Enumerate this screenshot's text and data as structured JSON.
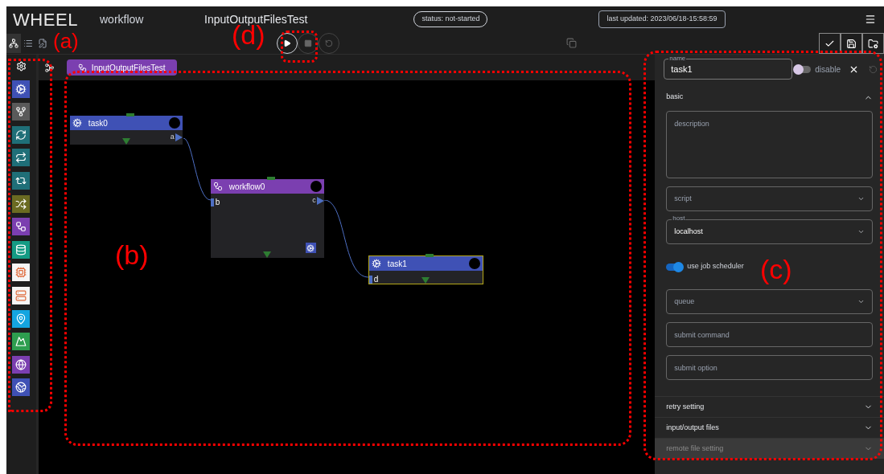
{
  "header": {
    "logo": "WHEEL",
    "mode": "workflow",
    "project_name": "InputOutputFilesTest",
    "status": "status: not-started",
    "last_updated": "last updated: 2023/06/18-15:58:59"
  },
  "view_tabs": [
    {
      "kind": "graph",
      "selected": true
    },
    {
      "kind": "list",
      "selected": false
    },
    {
      "kind": "editor",
      "selected": false
    }
  ],
  "run_controls": [
    {
      "kind": "run",
      "disabled": false
    },
    {
      "kind": "stop",
      "disabled": true
    },
    {
      "kind": "reset",
      "disabled": true
    }
  ],
  "project_actions": [
    {
      "kind": "check"
    },
    {
      "kind": "save"
    },
    {
      "kind": "folder"
    }
  ],
  "palette": [
    {
      "kind": "task",
      "color": "#3f51b5"
    },
    {
      "kind": "if",
      "color": "#5a5a5a"
    },
    {
      "kind": "for",
      "color": "#1f6f78"
    },
    {
      "kind": "while",
      "color": "#1f6f78"
    },
    {
      "kind": "foreach",
      "color": "#1f6f78"
    },
    {
      "kind": "ps",
      "color": "#6b6b22"
    },
    {
      "kind": "workflow",
      "color": "#7b3fb0"
    },
    {
      "kind": "storage",
      "color": "#149b84"
    },
    {
      "kind": "hpci",
      "color": "#f5f5f5"
    },
    {
      "kind": "hpci2",
      "color": "#f5f5f5"
    },
    {
      "kind": "source",
      "color": "#14a5e0"
    },
    {
      "kind": "viewer",
      "color": "#2e9e4f"
    },
    {
      "kind": "cloud",
      "color": "#7b3fb0"
    },
    {
      "kind": "cloud2",
      "color": "#3f51b5"
    }
  ],
  "canvas": {
    "breadcrumb": "InputOutputFilesTest",
    "nodes": [
      {
        "name": "task0",
        "kind": "task",
        "selected": false,
        "outputs": [
          "a"
        ]
      },
      {
        "name": "workflow0",
        "kind": "workflow",
        "selected": false,
        "inputs": [
          "b"
        ],
        "outputs": [
          "c"
        ]
      },
      {
        "name": "task1",
        "kind": "task",
        "selected": true,
        "inputs": [
          "d"
        ]
      }
    ]
  },
  "panel": {
    "name_label": "name",
    "name": "task1",
    "disable": {
      "label": "disable",
      "on": false
    },
    "sections": [
      {
        "title": "basic",
        "expanded": true,
        "disabled": false
      },
      {
        "title": "retry setting",
        "expanded": false,
        "disabled": false
      },
      {
        "title": "input/output files",
        "expanded": false,
        "disabled": false
      },
      {
        "title": "remote file setting",
        "expanded": false,
        "disabled": true
      }
    ],
    "fields": [
      {
        "kind": "textarea",
        "placeholder": "description"
      },
      {
        "kind": "select",
        "placeholder": "script"
      },
      {
        "kind": "select",
        "label": "host",
        "value": "localhost"
      },
      {
        "kind": "toggle",
        "label": "use job scheduler",
        "on": true
      },
      {
        "kind": "select",
        "placeholder": "queue"
      },
      {
        "kind": "text",
        "placeholder": "submit command"
      },
      {
        "kind": "text",
        "placeholder": "submit option"
      }
    ]
  },
  "annotations": [
    "(a)",
    "(d)",
    "(b)",
    "(c)"
  ]
}
